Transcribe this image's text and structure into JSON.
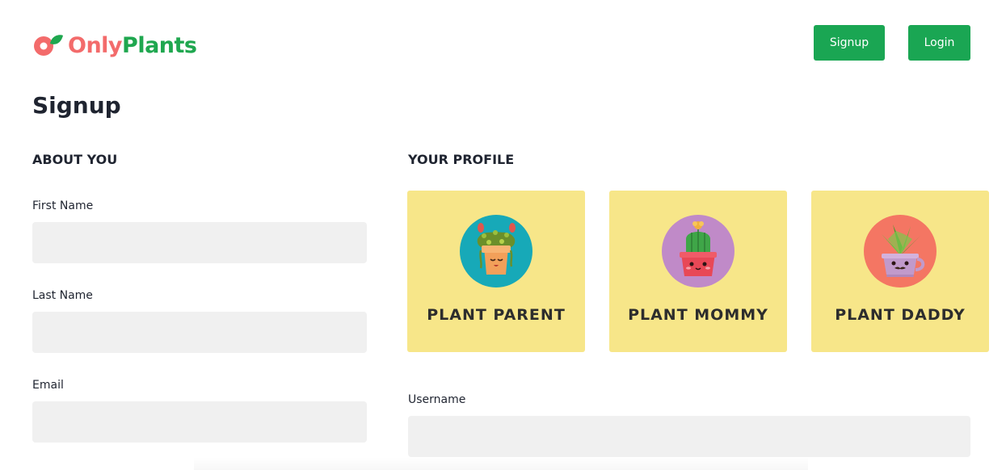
{
  "brand": {
    "part1": "Only",
    "part2": "Plants",
    "primary_color": "#f36b6b",
    "secondary_color": "#1fa74f"
  },
  "nav": {
    "signup_label": "Signup",
    "login_label": "Login",
    "button_color": "#1aa653"
  },
  "page": {
    "title": "Signup"
  },
  "about": {
    "heading": "ABOUT YOU",
    "fields": [
      {
        "label": "First Name",
        "value": ""
      },
      {
        "label": "Last Name",
        "value": ""
      },
      {
        "label": "Email",
        "value": ""
      }
    ]
  },
  "profile": {
    "heading": "YOUR PROFILE",
    "cards": [
      {
        "label": "PLANT PARENT",
        "icon": "succulent-pot-icon",
        "avatar_color": "#17a9b8"
      },
      {
        "label": "PLANT MOMMY",
        "icon": "cactus-pot-icon",
        "avatar_color": "#c08ac8"
      },
      {
        "label": "PLANT DADDY",
        "icon": "aloe-cup-icon",
        "avatar_color": "#f47663"
      }
    ],
    "username_label": "Username",
    "username_value": ""
  }
}
